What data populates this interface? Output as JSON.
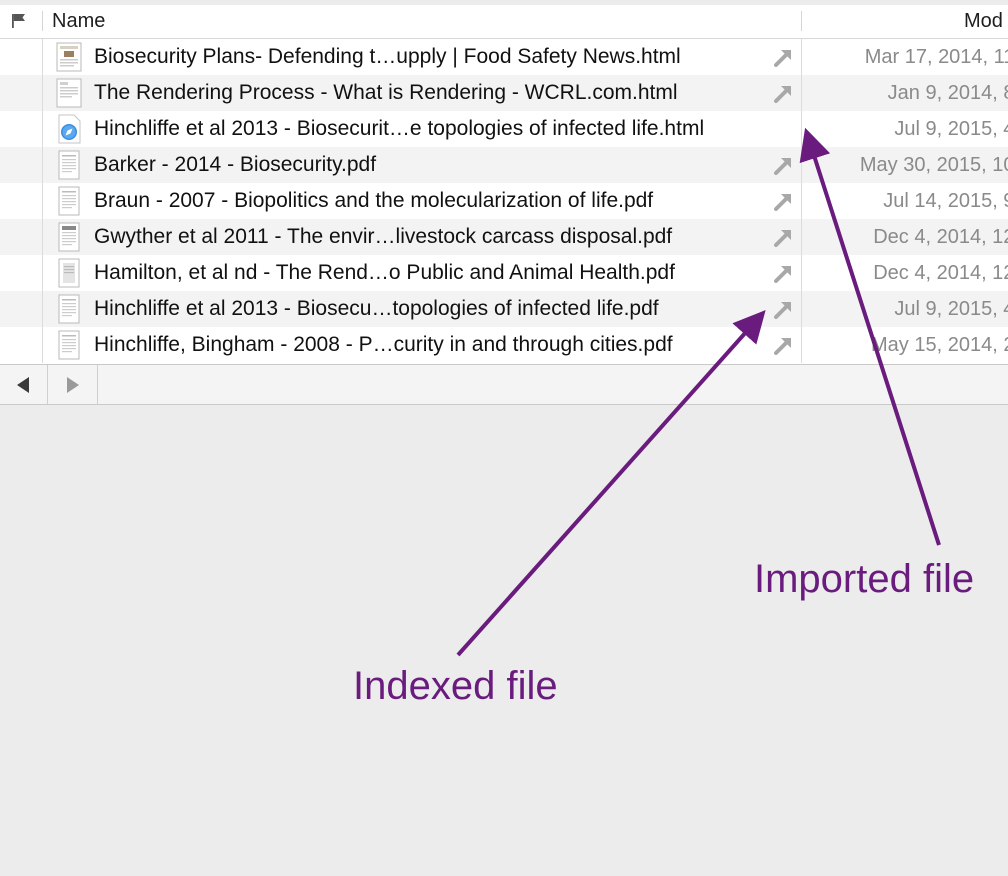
{
  "columns": {
    "name": "Name",
    "modified": "Mod"
  },
  "files": [
    {
      "name": "Biosecurity Plans- Defending t…upply | Food Safety News.html",
      "date": "Mar 17, 2014, 11:",
      "icon": "html-thumbnail-icon",
      "indexed": true
    },
    {
      "name": "The Rendering Process - What is Rendering - WCRL.com.html",
      "date": "Jan 9, 2014, 8:",
      "icon": "html-thumbnail-icon",
      "indexed": true
    },
    {
      "name": "Hinchliffe et al 2013 - Biosecurit…e topologies of infected life.html",
      "date": "Jul 9, 2015, 4:",
      "icon": "safari-html-icon",
      "indexed": false
    },
    {
      "name": "Barker - 2014 - Biosecurity.pdf",
      "date": "May 30, 2015, 10:",
      "icon": "pdf-document-icon",
      "indexed": true
    },
    {
      "name": "Braun - 2007 - Biopolitics and the molecularization of life.pdf",
      "date": "Jul 14, 2015, 9:",
      "icon": "pdf-document-icon",
      "indexed": true
    },
    {
      "name": "Gwyther et al 2011 - The envir…livestock carcass disposal.pdf",
      "date": "Dec 4, 2014, 12:",
      "icon": "pdf-document-icon",
      "indexed": true
    },
    {
      "name": "Hamilton, et al nd - The Rend…o Public and Animal Health.pdf",
      "date": "Dec 4, 2014, 12:",
      "icon": "pdf-document-icon",
      "indexed": true
    },
    {
      "name": "Hinchliffe et al 2013 - Biosecu…topologies of infected life.pdf",
      "date": "Jul 9, 2015, 4:",
      "icon": "pdf-document-icon",
      "indexed": true
    },
    {
      "name": "Hinchliffe, Bingham - 2008 - P…curity in and through cities.pdf",
      "date": "May 15, 2014, 2:",
      "icon": "pdf-document-icon",
      "indexed": true
    }
  ],
  "navigation": {
    "back_icon": "back-arrow-icon",
    "forward_icon": "forward-arrow-icon"
  },
  "annotations": {
    "indexed_label": "Indexed file",
    "imported_label": "Imported file",
    "color": "#6a1b7e"
  }
}
